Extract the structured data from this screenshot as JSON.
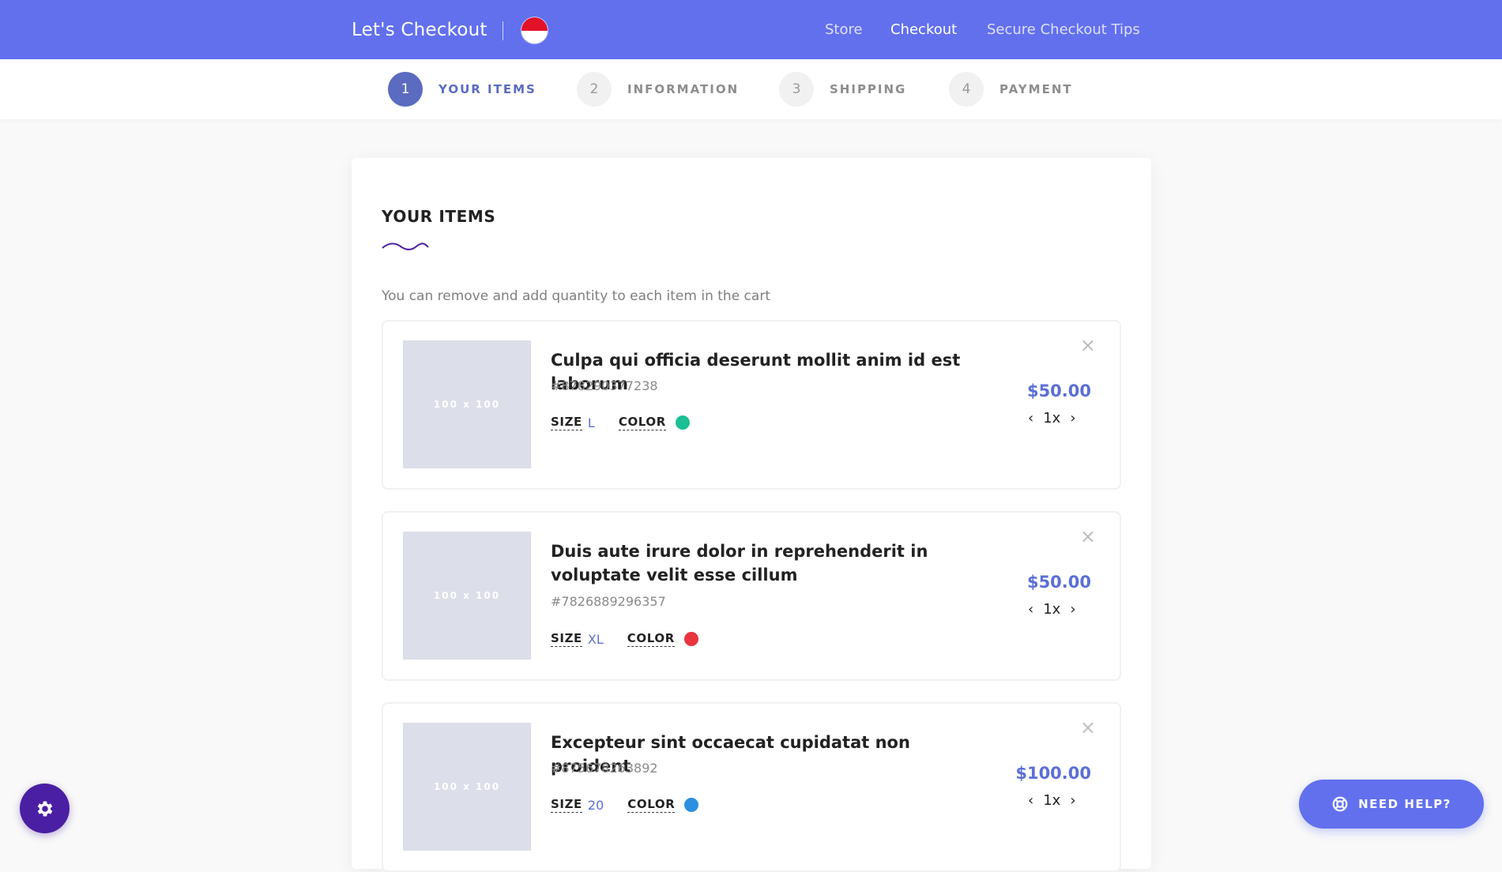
{
  "header": {
    "brand": "Let's Checkout",
    "flag_icon": "indonesia-flag-icon",
    "nav": [
      "Store",
      "Checkout",
      "Secure Checkout Tips"
    ],
    "active_nav": "Checkout",
    "color": "#6270ee"
  },
  "steps": [
    {
      "num": "1",
      "label": "YOUR ITEMS",
      "active": true
    },
    {
      "num": "2",
      "label": "INFORMATION",
      "active": false
    },
    {
      "num": "3",
      "label": "SHIPPING",
      "active": false
    },
    {
      "num": "4",
      "label": "PAYMENT",
      "active": false
    }
  ],
  "cart": {
    "title": "YOUR ITEMS",
    "subtitle": "You can remove and add quantity to each item in the cart",
    "size_label": "SIZE",
    "color_label": "COLOR",
    "items": [
      {
        "thumb": "100 x 100",
        "name": "Culpa qui officia deserunt mollit anim id est laborum",
        "sku": "#878290377238",
        "size": "L",
        "color": "#1dbf95",
        "price": "$50.00",
        "qty": "1x"
      },
      {
        "thumb": "100 x 100",
        "name": "Duis aute irure dolor in reprehenderit in voluptate velit esse cillum",
        "sku": "#7826889296357",
        "size": "XL",
        "color": "#e8343f",
        "price": "$50.00",
        "qty": "1x"
      },
      {
        "thumb": "100 x 100",
        "name": "Excepteur sint occaecat cupidatat non proident",
        "sku": "#875678263892",
        "size": "20",
        "color": "#2e8fe0",
        "price": "$100.00",
        "qty": "1x"
      }
    ]
  },
  "help": {
    "label": "NEED HELP?",
    "icon": "lifebuoy-icon"
  },
  "settings": {
    "icon": "gear-icon"
  }
}
